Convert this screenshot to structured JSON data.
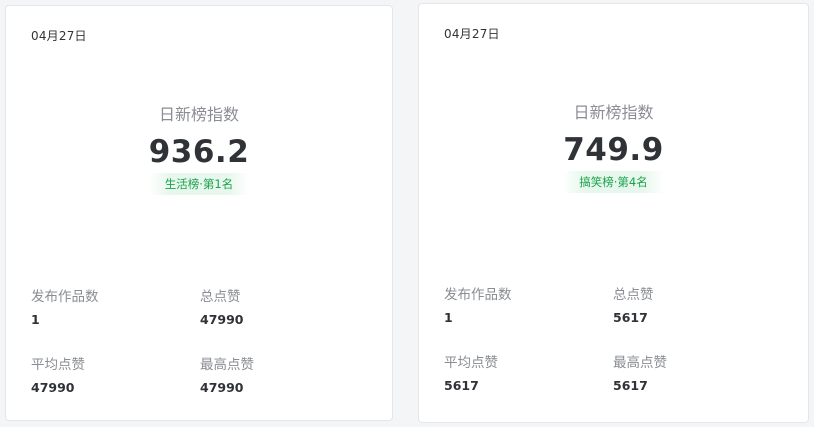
{
  "cards": [
    {
      "date": "04月27日",
      "index_label": "日新榜指数",
      "index_value": "936.2",
      "rank": "生活榜·第1名",
      "stats": [
        {
          "label": "发布作品数",
          "value": "1"
        },
        {
          "label": "总点赞",
          "value": "47990"
        },
        {
          "label": "平均点赞",
          "value": "47990"
        },
        {
          "label": "最高点赞",
          "value": "47990"
        }
      ]
    },
    {
      "date": "04月27日",
      "index_label": "日新榜指数",
      "index_value": "749.9",
      "rank": "搞笑榜·第4名",
      "stats": [
        {
          "label": "发布作品数",
          "value": "1"
        },
        {
          "label": "总点赞",
          "value": "5617"
        },
        {
          "label": "平均点赞",
          "value": "5617"
        },
        {
          "label": "最高点赞",
          "value": "5617"
        }
      ]
    }
  ],
  "colors": {
    "rank_text": "#1aa34a",
    "rank_bg": "#e8f7ed",
    "card_border": "#e4e6ea"
  }
}
